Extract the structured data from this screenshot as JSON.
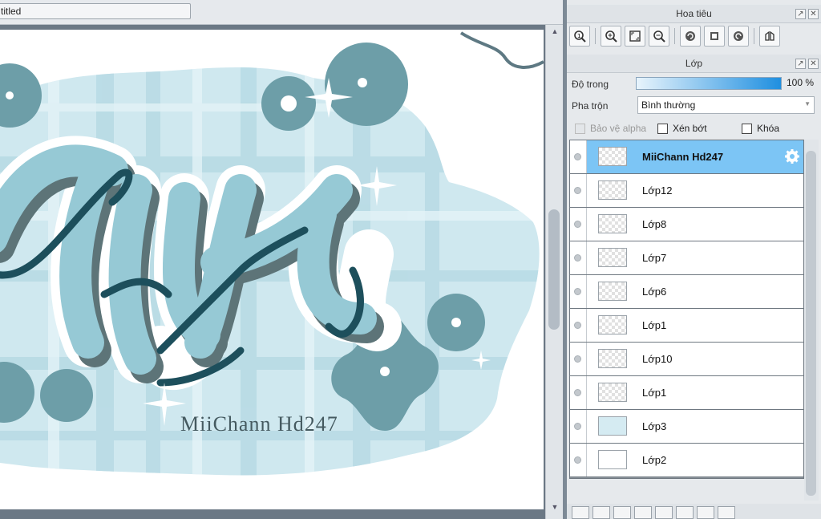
{
  "document": {
    "tab_title": "titled"
  },
  "navigator": {
    "title": "Hoa tiêu",
    "tools": [
      "zoom-actual-icon",
      "zoom-in-icon",
      "fit-screen-icon",
      "zoom-out-icon",
      "rotate-left-icon",
      "fit-page-icon",
      "rotate-right-icon",
      "flip-icon"
    ]
  },
  "layers_panel": {
    "title": "Lớp",
    "opacity_label": "Độ trong",
    "opacity_value": "100 %",
    "opacity_fraction": 1.0,
    "blend_label": "Pha trộn",
    "blend_value": "Bình thường",
    "protect_alpha_label": "Bảo vệ alpha",
    "clip_label": "Xén bớt",
    "lock_label": "Khóa",
    "layers": [
      {
        "name": "MiiChann Hd247",
        "selected": true
      },
      {
        "name": "Lớp12"
      },
      {
        "name": "Lớp8"
      },
      {
        "name": "Lớp7"
      },
      {
        "name": "Lớp6"
      },
      {
        "name": "Lớp1"
      },
      {
        "name": "Lớp10"
      },
      {
        "name": "Lớp1"
      },
      {
        "name": "Lớp3"
      },
      {
        "name": "Lớp2"
      }
    ]
  },
  "canvas": {
    "signature_text": "MiiChann Hd247"
  },
  "colors": {
    "selected_layer": "#7cc5f5",
    "artwork_light": "#c9e5ee",
    "artwork_dark": "#6ea0aa",
    "letter_dark": "#1d4f5c"
  }
}
